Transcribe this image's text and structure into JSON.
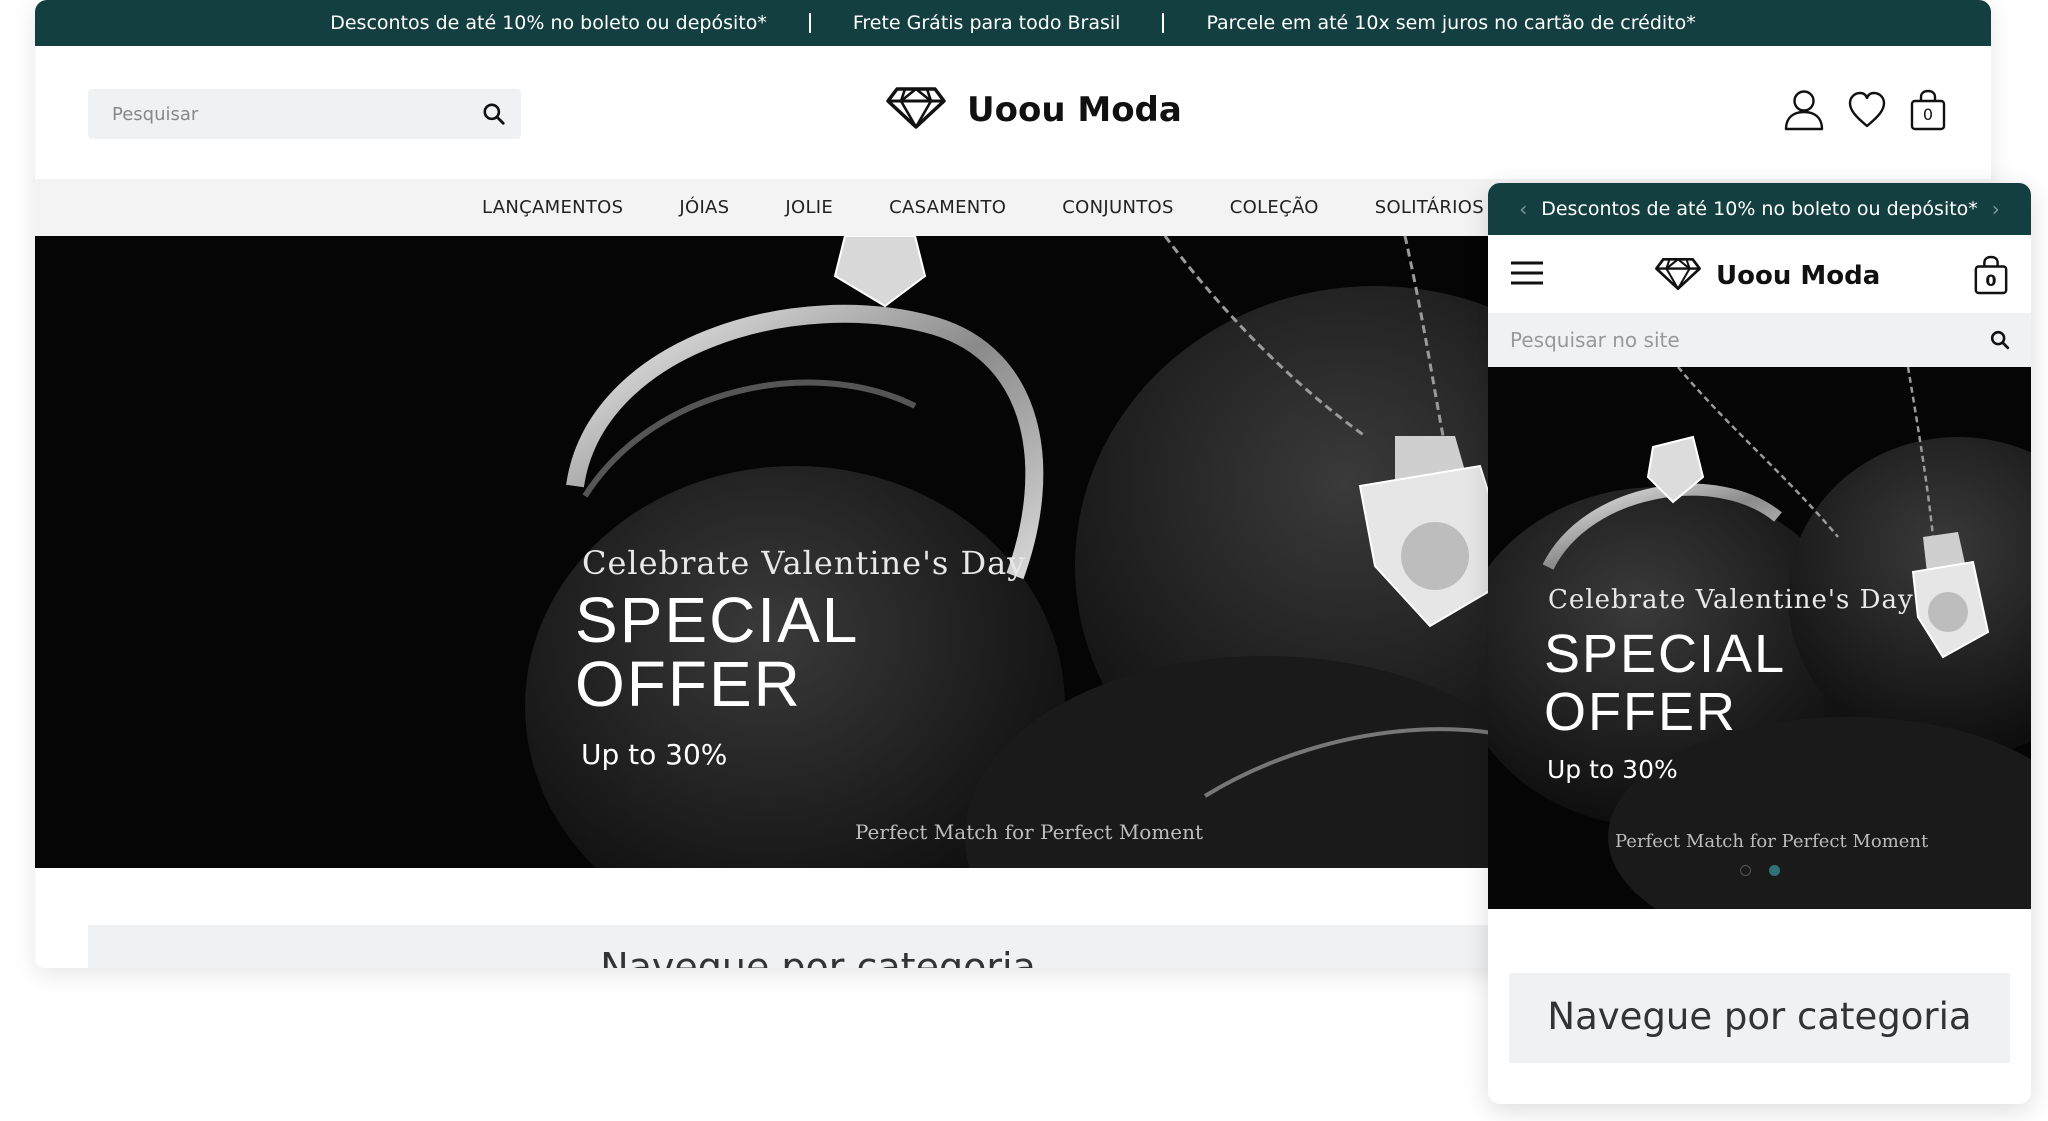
{
  "desktop": {
    "topbar": {
      "messages": [
        "Descontos de até 10% no boleto ou depósito*",
        "Frete Grátis para todo Brasil",
        "Parcele em até 10x sem juros no cartão de crédito*"
      ]
    },
    "search": {
      "placeholder": "Pesquisar"
    },
    "logo": {
      "text": "Uoou Moda",
      "icon": "diamond-icon"
    },
    "actions": {
      "account_icon": "user-icon",
      "wishlist_icon": "heart-icon",
      "bag_icon": "shopping-bag-icon",
      "bag_count": "0"
    },
    "nav": [
      "LANÇAMENTOS",
      "JÓIAS",
      "JOLIE",
      "CASAMENTO",
      "CONJUNTOS",
      "COLEÇÃO",
      "SOLITÁRIOS"
    ],
    "hero": {
      "tagline": "Celebrate Valentine's Day",
      "headline_line1": "SPECIAL",
      "headline_line2": "OFFER",
      "sub": "Up to 30%",
      "foot": "Perfect Match for Perfect Moment"
    },
    "category_title": "Navegue por categoria"
  },
  "mobile": {
    "topbar": {
      "message": "Descontos de até 10% no boleto ou depósito*",
      "prev": "‹",
      "next": "›"
    },
    "logo": {
      "text": "Uoou Moda",
      "icon": "diamond-icon"
    },
    "menu_icon": "hamburger-icon",
    "bag_count": "0",
    "search": {
      "placeholder": "Pesquisar no site"
    },
    "hero": {
      "tagline": "Celebrate Valentine's Day",
      "headline_line1": "SPECIAL",
      "headline_line2": "OFFER",
      "sub": "Up to 30%",
      "foot": "Perfect Match for Perfect Moment",
      "slide_count": 2,
      "active_slide": 2
    },
    "category_title": "Navegue por categoria"
  },
  "colors": {
    "topbar": "#143f41",
    "nav_bg": "#f3f3f4",
    "search_bg": "#f0f1f3",
    "dot_active": "#2f7277"
  }
}
